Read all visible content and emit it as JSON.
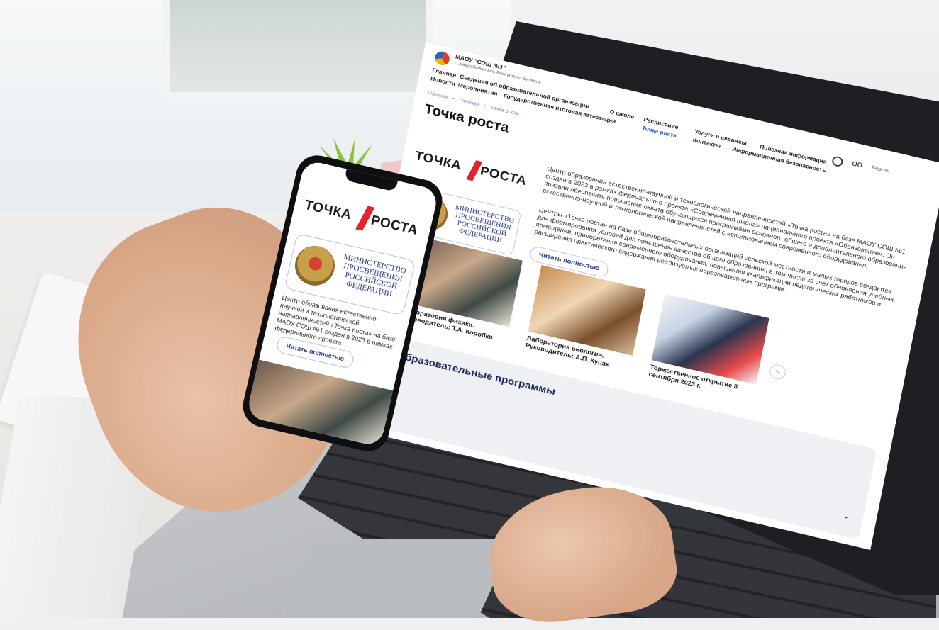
{
  "site": {
    "org_name": "МАОУ \"СОШ №1\"",
    "org_sub": "г.Северобайкальск, Республика Бурятия",
    "nav": [
      "Главная",
      "Сведения об образовательной организации",
      "О школе",
      "Расписание",
      "Услуги и сервисы",
      "Полезная информация"
    ],
    "nav2": [
      "Новости",
      "Мероприятия",
      "Государственная итоговая аттестация",
      "Точка роста",
      "Контакты",
      "Информационная безопасность"
    ],
    "breadcrumb": [
      "Главная",
      "•",
      "Главная",
      "•",
      "Точка роста"
    ],
    "version_label": "Версия",
    "page_title": "Точка роста",
    "logo_left": "ТОЧКА",
    "logo_right": "РОСТА",
    "ministry": [
      "МИНИСТЕРСТВО",
      "ПРОСВЕЩЕНИЯ",
      "РОССИЙСКОЙ",
      "ФЕДЕРАЦИИ"
    ],
    "para1": "Центр образования естественно-научной и технологической направленностей «Точка роста» на базе МАОУ СОШ №1 создан в 2023 в рамках федерального проекта «Современная школа» национального проекта «Образование». Он призван обеспечить повышение охвата обучающихся программами основного общего и дополнительного образования естественно-научной и технологической направленностей с использованием современного оборудования.",
    "para2": "Центры «Точка роста» на базе общеобразовательных организаций сельской местности и малых городов создаются для формирования условий для повышения качества общего образования, в том числе за счет обновления учебных помещений, приобретения современного оборудования, повышения квалификации педагогических работников и расширения практического содержания реализуемых образовательных программ.",
    "read_more": "Читать полностью",
    "arrow_prev": "<",
    "arrow_next": ">",
    "gallery": [
      {
        "caption": "Лаборатория физики. Руководитель: Т.А. Коробко"
      },
      {
        "caption": "Лаборатория биологии. Руководитель: А.П. Куцак"
      },
      {
        "caption": "Торжественное открытие 8 сентября 2023 г."
      }
    ],
    "edu_title": "Образовательные программы",
    "chevron": "⌄"
  },
  "phone": {
    "logo_left": "ТОЧКА",
    "logo_right": "РОСТА",
    "ministry": [
      "МИНИСТЕРСТВО",
      "ПРОСВЕЩЕНИЯ",
      "РОССИЙСКОЙ",
      "ФЕДЕРАЦИИ"
    ],
    "para": "Центр образования естественно-научной и технологической направленностей «Точка роста» на базе МАОУ СОШ №1 создан в 2023 в рамках федерального проекта",
    "read_more": "Читать полностью"
  },
  "colors": {
    "accent_red": "#e4232d",
    "link_blue": "#2c3e8a",
    "nav_active": "#2a5bd7"
  }
}
